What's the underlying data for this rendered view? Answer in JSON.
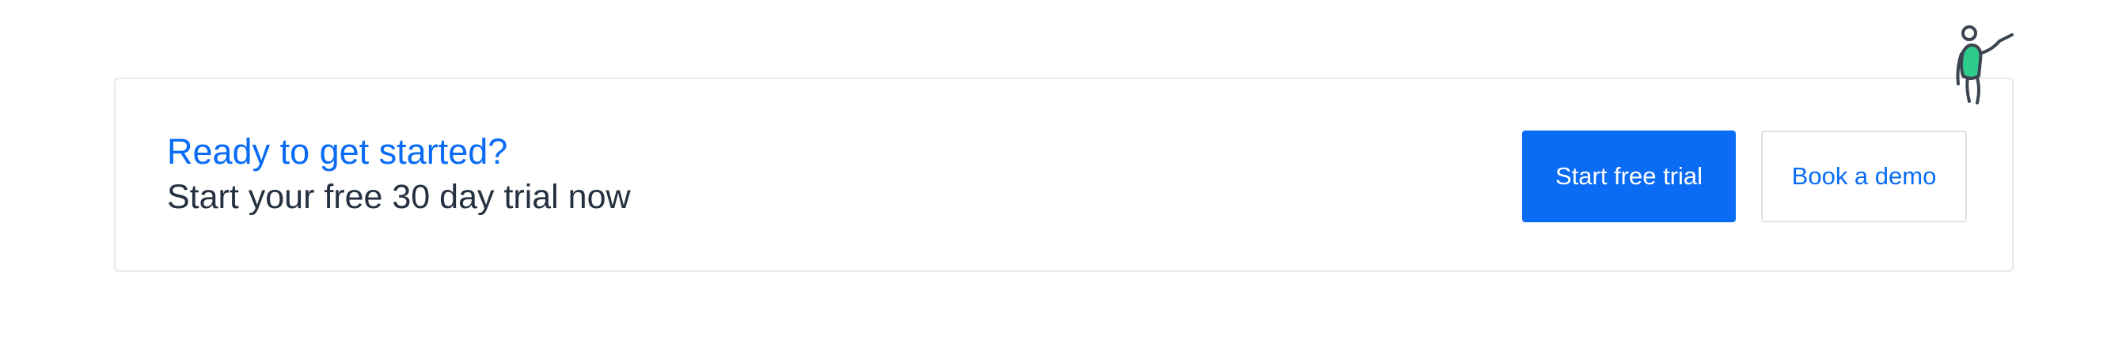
{
  "cta": {
    "heading": "Ready to get started?",
    "subheading": "Start your free 30 day trial now",
    "primary_button": "Start free trial",
    "secondary_button": "Book a demo"
  },
  "mascot": {
    "icon": "waving-person-icon"
  },
  "colors": {
    "accent": "#0a6cf5",
    "text_dark": "#253040",
    "border": "#e6e8ec",
    "mascot_body": "#2ecc8a",
    "mascot_outline": "#3c4451"
  }
}
